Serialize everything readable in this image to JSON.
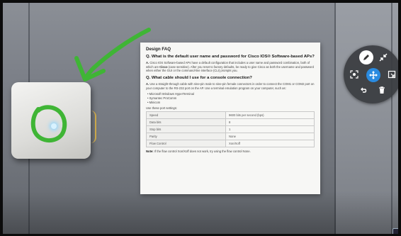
{
  "faq": {
    "title": "Design FAQ",
    "q1": "Q. What is the default user name and password for Cisco IOS® Software-based APs?",
    "a1_prefix": "A.",
    "a1_text": "Cisco IOS Software-based APs have a default configuration that includes a user name and password combination, both of which are",
    "a1_bold": "Cisco",
    "a1_rest": "(case sensitive). After you reset to factory defaults, be ready to give Cisco as both the username and password when either the GUI or the command-line interface (CLI) prompts you.",
    "q2": "Q. What cable should I use for a console connection?",
    "a2_prefix": "A.",
    "a2_text": "Use a straight-through cable with nine-pin male to nine-pin female connectors in order to connect the COM1 or COM2 port on your computer to the RS-232 port on the AP. Use a terminal emulation program on your computer, such as:",
    "programs": [
      "Microsoft Windows HyperTerminal",
      "Symantec ProComm",
      "Minicom"
    ],
    "settings_intro": "Use these port settings:",
    "port_settings": [
      {
        "label": "Speed",
        "value": "9600 bits per second (bps)"
      },
      {
        "label": "Data bits",
        "value": "8"
      },
      {
        "label": "Stop bits",
        "value": "1"
      },
      {
        "label": "Parity",
        "value": "None"
      },
      {
        "label": "Flow Control",
        "value": "Xon/Xoff"
      }
    ],
    "note_label": "Note:",
    "note_text": "If the flow control Xon/Xoff does not work, try using the flow control None."
  },
  "tools": {
    "pen": "pen-icon",
    "collapse": "collapse-arrows-icon",
    "capture": "capture-icon",
    "move": "move-icon",
    "pin": "pin-icon",
    "undo": "undo-icon",
    "delete": "trash-icon"
  },
  "colors": {
    "ink": "#3fb535",
    "accent": "#2a8be0",
    "menu_bg": "#3a3c40"
  }
}
